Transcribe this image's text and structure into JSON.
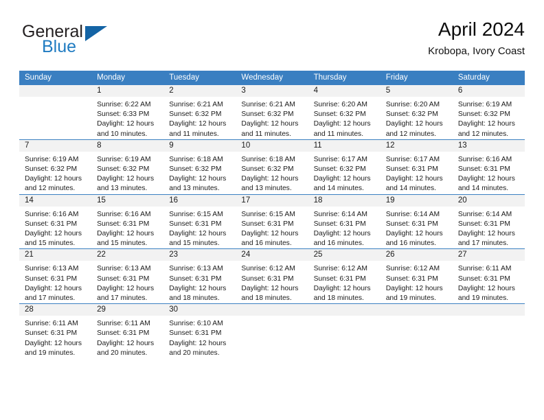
{
  "brand": {
    "name_top": "General",
    "name_bottom": "Blue",
    "accent_color": "#1f7bc1",
    "triangle_color": "#1464a5",
    "logo_icon": "triangle-icon"
  },
  "header": {
    "title": "April 2024",
    "subtitle": "Krobopa, Ivory Coast"
  },
  "calendar": {
    "header_bg": "#3a7fc1",
    "header_text_color": "#ffffff",
    "daynum_band_bg": "#f2f2f2",
    "weekday_headers": [
      "Sunday",
      "Monday",
      "Tuesday",
      "Wednesday",
      "Thursday",
      "Friday",
      "Saturday"
    ],
    "weeks": [
      [
        {
          "day": "",
          "sunrise": "",
          "sunset": "",
          "daylight_line1": "",
          "daylight_line2": ""
        },
        {
          "day": "1",
          "sunrise": "Sunrise: 6:22 AM",
          "sunset": "Sunset: 6:33 PM",
          "daylight_line1": "Daylight: 12 hours",
          "daylight_line2": "and 10 minutes."
        },
        {
          "day": "2",
          "sunrise": "Sunrise: 6:21 AM",
          "sunset": "Sunset: 6:32 PM",
          "daylight_line1": "Daylight: 12 hours",
          "daylight_line2": "and 11 minutes."
        },
        {
          "day": "3",
          "sunrise": "Sunrise: 6:21 AM",
          "sunset": "Sunset: 6:32 PM",
          "daylight_line1": "Daylight: 12 hours",
          "daylight_line2": "and 11 minutes."
        },
        {
          "day": "4",
          "sunrise": "Sunrise: 6:20 AM",
          "sunset": "Sunset: 6:32 PM",
          "daylight_line1": "Daylight: 12 hours",
          "daylight_line2": "and 11 minutes."
        },
        {
          "day": "5",
          "sunrise": "Sunrise: 6:20 AM",
          "sunset": "Sunset: 6:32 PM",
          "daylight_line1": "Daylight: 12 hours",
          "daylight_line2": "and 12 minutes."
        },
        {
          "day": "6",
          "sunrise": "Sunrise: 6:19 AM",
          "sunset": "Sunset: 6:32 PM",
          "daylight_line1": "Daylight: 12 hours",
          "daylight_line2": "and 12 minutes."
        }
      ],
      [
        {
          "day": "7",
          "sunrise": "Sunrise: 6:19 AM",
          "sunset": "Sunset: 6:32 PM",
          "daylight_line1": "Daylight: 12 hours",
          "daylight_line2": "and 12 minutes."
        },
        {
          "day": "8",
          "sunrise": "Sunrise: 6:19 AM",
          "sunset": "Sunset: 6:32 PM",
          "daylight_line1": "Daylight: 12 hours",
          "daylight_line2": "and 13 minutes."
        },
        {
          "day": "9",
          "sunrise": "Sunrise: 6:18 AM",
          "sunset": "Sunset: 6:32 PM",
          "daylight_line1": "Daylight: 12 hours",
          "daylight_line2": "and 13 minutes."
        },
        {
          "day": "10",
          "sunrise": "Sunrise: 6:18 AM",
          "sunset": "Sunset: 6:32 PM",
          "daylight_line1": "Daylight: 12 hours",
          "daylight_line2": "and 13 minutes."
        },
        {
          "day": "11",
          "sunrise": "Sunrise: 6:17 AM",
          "sunset": "Sunset: 6:32 PM",
          "daylight_line1": "Daylight: 12 hours",
          "daylight_line2": "and 14 minutes."
        },
        {
          "day": "12",
          "sunrise": "Sunrise: 6:17 AM",
          "sunset": "Sunset: 6:31 PM",
          "daylight_line1": "Daylight: 12 hours",
          "daylight_line2": "and 14 minutes."
        },
        {
          "day": "13",
          "sunrise": "Sunrise: 6:16 AM",
          "sunset": "Sunset: 6:31 PM",
          "daylight_line1": "Daylight: 12 hours",
          "daylight_line2": "and 14 minutes."
        }
      ],
      [
        {
          "day": "14",
          "sunrise": "Sunrise: 6:16 AM",
          "sunset": "Sunset: 6:31 PM",
          "daylight_line1": "Daylight: 12 hours",
          "daylight_line2": "and 15 minutes."
        },
        {
          "day": "15",
          "sunrise": "Sunrise: 6:16 AM",
          "sunset": "Sunset: 6:31 PM",
          "daylight_line1": "Daylight: 12 hours",
          "daylight_line2": "and 15 minutes."
        },
        {
          "day": "16",
          "sunrise": "Sunrise: 6:15 AM",
          "sunset": "Sunset: 6:31 PM",
          "daylight_line1": "Daylight: 12 hours",
          "daylight_line2": "and 15 minutes."
        },
        {
          "day": "17",
          "sunrise": "Sunrise: 6:15 AM",
          "sunset": "Sunset: 6:31 PM",
          "daylight_line1": "Daylight: 12 hours",
          "daylight_line2": "and 16 minutes."
        },
        {
          "day": "18",
          "sunrise": "Sunrise: 6:14 AM",
          "sunset": "Sunset: 6:31 PM",
          "daylight_line1": "Daylight: 12 hours",
          "daylight_line2": "and 16 minutes."
        },
        {
          "day": "19",
          "sunrise": "Sunrise: 6:14 AM",
          "sunset": "Sunset: 6:31 PM",
          "daylight_line1": "Daylight: 12 hours",
          "daylight_line2": "and 16 minutes."
        },
        {
          "day": "20",
          "sunrise": "Sunrise: 6:14 AM",
          "sunset": "Sunset: 6:31 PM",
          "daylight_line1": "Daylight: 12 hours",
          "daylight_line2": "and 17 minutes."
        }
      ],
      [
        {
          "day": "21",
          "sunrise": "Sunrise: 6:13 AM",
          "sunset": "Sunset: 6:31 PM",
          "daylight_line1": "Daylight: 12 hours",
          "daylight_line2": "and 17 minutes."
        },
        {
          "day": "22",
          "sunrise": "Sunrise: 6:13 AM",
          "sunset": "Sunset: 6:31 PM",
          "daylight_line1": "Daylight: 12 hours",
          "daylight_line2": "and 17 minutes."
        },
        {
          "day": "23",
          "sunrise": "Sunrise: 6:13 AM",
          "sunset": "Sunset: 6:31 PM",
          "daylight_line1": "Daylight: 12 hours",
          "daylight_line2": "and 18 minutes."
        },
        {
          "day": "24",
          "sunrise": "Sunrise: 6:12 AM",
          "sunset": "Sunset: 6:31 PM",
          "daylight_line1": "Daylight: 12 hours",
          "daylight_line2": "and 18 minutes."
        },
        {
          "day": "25",
          "sunrise": "Sunrise: 6:12 AM",
          "sunset": "Sunset: 6:31 PM",
          "daylight_line1": "Daylight: 12 hours",
          "daylight_line2": "and 18 minutes."
        },
        {
          "day": "26",
          "sunrise": "Sunrise: 6:12 AM",
          "sunset": "Sunset: 6:31 PM",
          "daylight_line1": "Daylight: 12 hours",
          "daylight_line2": "and 19 minutes."
        },
        {
          "day": "27",
          "sunrise": "Sunrise: 6:11 AM",
          "sunset": "Sunset: 6:31 PM",
          "daylight_line1": "Daylight: 12 hours",
          "daylight_line2": "and 19 minutes."
        }
      ],
      [
        {
          "day": "28",
          "sunrise": "Sunrise: 6:11 AM",
          "sunset": "Sunset: 6:31 PM",
          "daylight_line1": "Daylight: 12 hours",
          "daylight_line2": "and 19 minutes."
        },
        {
          "day": "29",
          "sunrise": "Sunrise: 6:11 AM",
          "sunset": "Sunset: 6:31 PM",
          "daylight_line1": "Daylight: 12 hours",
          "daylight_line2": "and 20 minutes."
        },
        {
          "day": "30",
          "sunrise": "Sunrise: 6:10 AM",
          "sunset": "Sunset: 6:31 PM",
          "daylight_line1": "Daylight: 12 hours",
          "daylight_line2": "and 20 minutes."
        },
        {
          "day": "",
          "sunrise": "",
          "sunset": "",
          "daylight_line1": "",
          "daylight_line2": ""
        },
        {
          "day": "",
          "sunrise": "",
          "sunset": "",
          "daylight_line1": "",
          "daylight_line2": ""
        },
        {
          "day": "",
          "sunrise": "",
          "sunset": "",
          "daylight_line1": "",
          "daylight_line2": ""
        },
        {
          "day": "",
          "sunrise": "",
          "sunset": "",
          "daylight_line1": "",
          "daylight_line2": ""
        }
      ]
    ]
  }
}
